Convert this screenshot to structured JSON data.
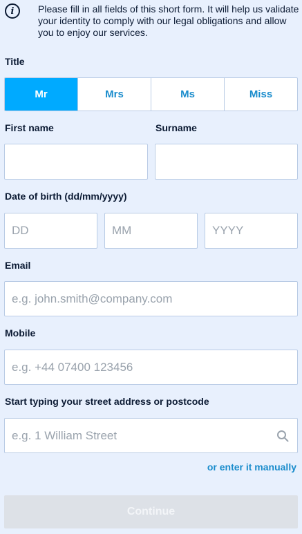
{
  "info": {
    "icon": "info-icon",
    "icon_glyph": "i",
    "text": "Please fill in all fields of this short form. It will help us validate your identity to comply with our legal obligations and allow you to enjoy our services."
  },
  "title_section": {
    "label": "Title",
    "options": [
      "Mr",
      "Mrs",
      "Ms",
      "Miss"
    ],
    "selected": "Mr"
  },
  "first_name": {
    "label": "First name",
    "value": "",
    "placeholder": ""
  },
  "surname": {
    "label": "Surname",
    "value": "",
    "placeholder": ""
  },
  "dob": {
    "label": "Date of birth (dd/mm/yyyy)",
    "day_placeholder": "DD",
    "month_placeholder": "MM",
    "year_placeholder": "YYYY"
  },
  "email": {
    "label": "Email",
    "placeholder": "e.g. john.smith@company.com"
  },
  "mobile": {
    "label": "Mobile",
    "placeholder": "e.g. +44 07400 123456"
  },
  "address": {
    "label": "Start typing your street address or postcode",
    "placeholder": "e.g. 1 William Street",
    "icon": "search-icon",
    "manual_link": "or enter it manually"
  },
  "continue_button": {
    "label": "Continue",
    "disabled": true
  },
  "colors": {
    "background": "#e8f0fd",
    "accent": "#00aaff",
    "link": "#1a8ccc",
    "text": "#0b1a33",
    "disabled_button": "#dde1e7"
  }
}
